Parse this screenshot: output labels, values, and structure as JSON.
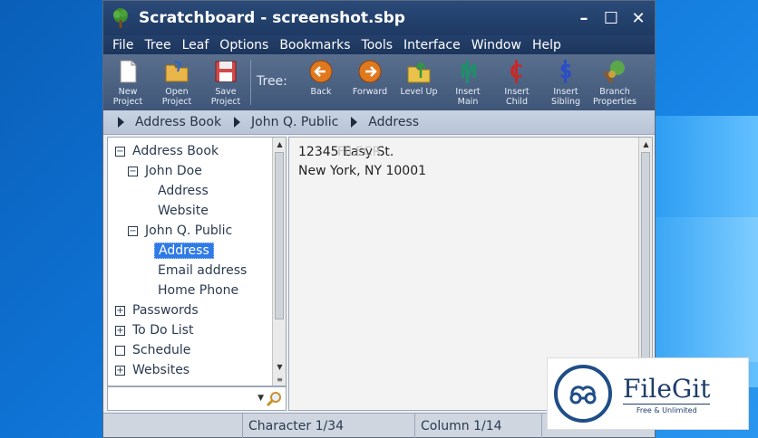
{
  "window": {
    "title": "Scratchboard - screenshot.sbp",
    "controls": [
      "–",
      "☐",
      "✕"
    ]
  },
  "menu": [
    "File",
    "Tree",
    "Leaf",
    "Options",
    "Bookmarks",
    "Tools",
    "Interface",
    "Window",
    "Help"
  ],
  "toolbar": {
    "file_buttons": [
      {
        "label": "New\nProject",
        "icon": "new-document-icon"
      },
      {
        "label": "Open\nProject",
        "icon": "open-folder-icon"
      },
      {
        "label": "Save\nProject",
        "icon": "save-disk-icon"
      }
    ],
    "tree_label": "Tree:",
    "tree_buttons": [
      {
        "label": "Back",
        "icon": "back-arrow-icon"
      },
      {
        "label": "Forward",
        "icon": "forward-arrow-icon"
      },
      {
        "label": "Level Up",
        "icon": "level-up-folder-icon"
      },
      {
        "label": "Insert\nMain",
        "icon": "insert-main-icon"
      },
      {
        "label": "Insert\nChild",
        "icon": "insert-child-icon"
      },
      {
        "label": "Insert\nSibling",
        "icon": "insert-sibling-icon"
      },
      {
        "label": "Branch\nProperties",
        "icon": "branch-properties-icon"
      }
    ]
  },
  "breadcrumb": [
    "Address Book",
    "John Q. Public",
    "Address"
  ],
  "tree": [
    {
      "label": "Address Book",
      "level": 0,
      "toggle": "minus"
    },
    {
      "label": "John Doe",
      "level": 1,
      "toggle": "minus"
    },
    {
      "label": "Address",
      "level": 2,
      "toggle": "none"
    },
    {
      "label": "Website",
      "level": 2,
      "toggle": "none"
    },
    {
      "label": "John Q. Public",
      "level": 1,
      "toggle": "minus"
    },
    {
      "label": "Address",
      "level": 2,
      "toggle": "none",
      "selected": true
    },
    {
      "label": "Email address",
      "level": 2,
      "toggle": "none"
    },
    {
      "label": "Home Phone",
      "level": 2,
      "toggle": "none"
    },
    {
      "label": "Passwords",
      "level": 0,
      "toggle": "plus"
    },
    {
      "label": "To Do List",
      "level": 0,
      "toggle": "plus"
    },
    {
      "label": "Schedule",
      "level": 0,
      "toggle": "empty"
    },
    {
      "label": "Websites",
      "level": 0,
      "toggle": "plus"
    }
  ],
  "editor": {
    "lines": [
      "12345 Easy St.",
      "New York, NY 10001"
    ]
  },
  "watermark": "FILECR",
  "status": {
    "character": "Character 1/34",
    "column": "Column 1/14"
  },
  "badge": {
    "title": "FileGit",
    "subtitle": "Free & Unlimited"
  },
  "colors": {
    "titlebar": "#1e3a64",
    "toolbar": "#4a6184",
    "selection": "#2f7ae5"
  }
}
